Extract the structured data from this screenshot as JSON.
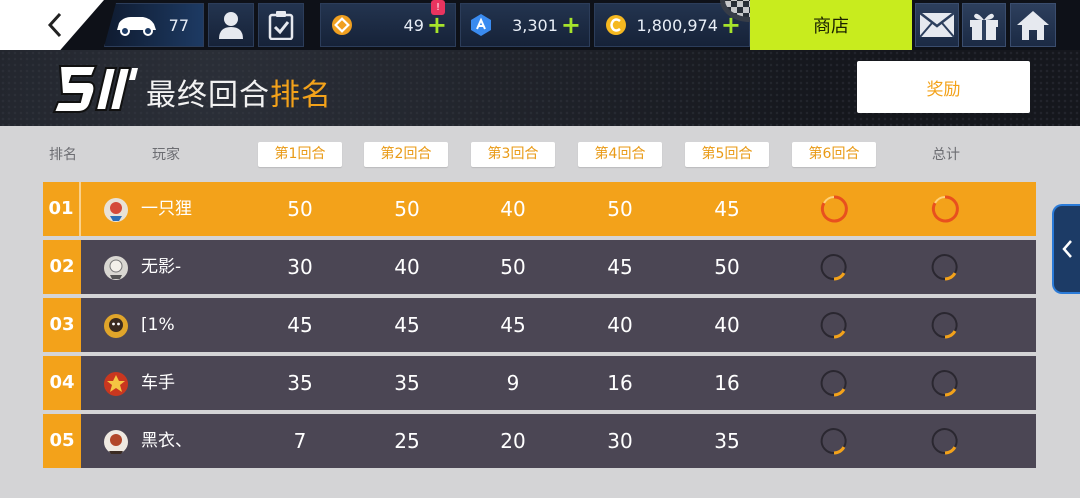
{
  "topbar": {
    "back_icon": "chevron-left-icon",
    "car_count": "77",
    "badge": "!",
    "currency_a": "49",
    "currency_b": "3,301",
    "currency_c": "1,800,974",
    "shop_label": "商店",
    "icons": [
      "car-icon",
      "profile-icon",
      "clipboard-check-icon",
      "diamond-token-icon",
      "blue-token-icon",
      "gold-coin-icon",
      "mail-icon",
      "gift-icon",
      "home-icon"
    ]
  },
  "header": {
    "title_main": "最终回合",
    "title_highlight": "排名",
    "reward_label": "奖励"
  },
  "table": {
    "headers": {
      "rank": "排名",
      "player": "玩家",
      "rounds": [
        "第1回合",
        "第2回合",
        "第3回合",
        "第4回合",
        "第5回合",
        "第6回合"
      ],
      "total": "总计"
    },
    "rows": [
      {
        "rank": "01",
        "name": "一只狸",
        "scores": [
          "50",
          "50",
          "40",
          "50",
          "45"
        ],
        "highlight": true
      },
      {
        "rank": "02",
        "name": "无影-",
        "scores": [
          "30",
          "40",
          "50",
          "45",
          "50"
        ],
        "highlight": false
      },
      {
        "rank": "03",
        "name": "[1%",
        "scores": [
          "45",
          "45",
          "45",
          "40",
          "40"
        ],
        "highlight": false
      },
      {
        "rank": "04",
        "name": "车手",
        "scores": [
          "35",
          "35",
          "9",
          "16",
          "16"
        ],
        "highlight": false
      },
      {
        "rank": "05",
        "name": "黑衣、",
        "scores": [
          "7",
          "25",
          "20",
          "30",
          "35"
        ],
        "highlight": false
      }
    ]
  },
  "colors": {
    "accent_orange": "#f3a21a",
    "row_dark": "#4b4654",
    "shop_green": "#c8ec1e",
    "plus_green": "#a6e42b"
  }
}
